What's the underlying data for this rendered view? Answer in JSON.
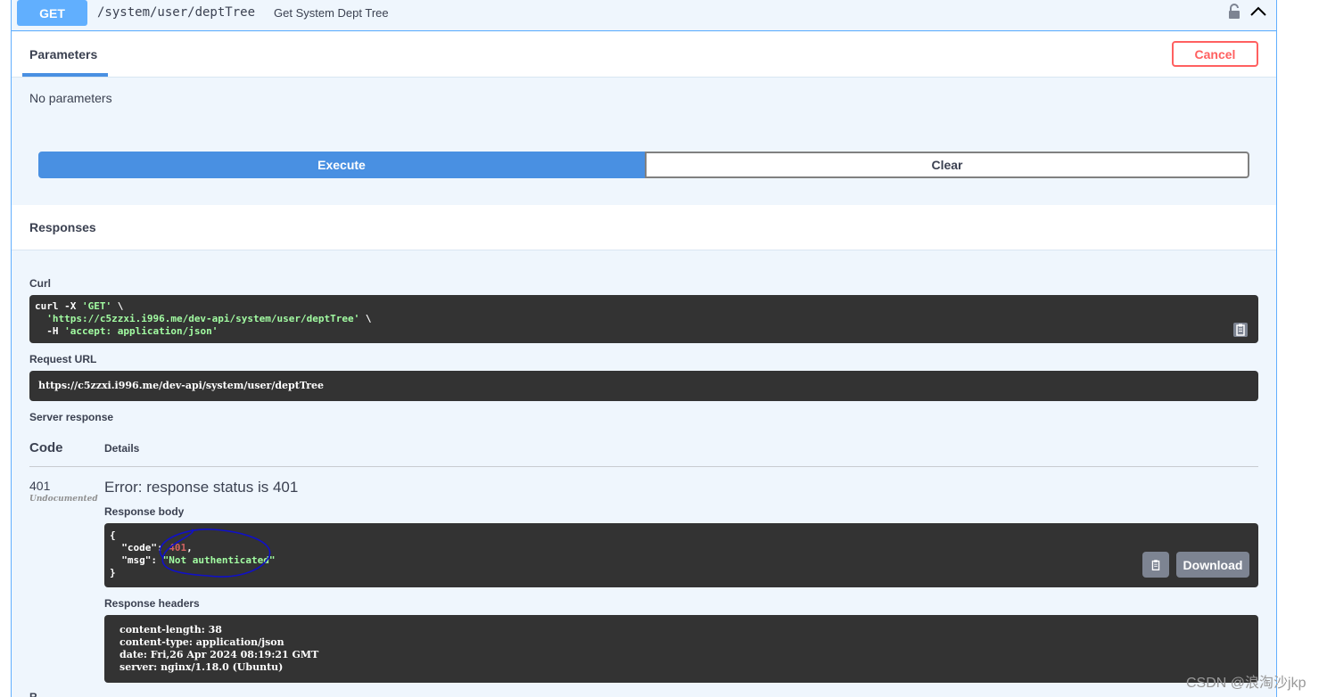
{
  "operation": {
    "method": "GET",
    "path": "/system/user/deptTree",
    "summary": "Get System Dept Tree"
  },
  "parameters": {
    "tab_label": "Parameters",
    "cancel_label": "Cancel",
    "empty_text": "No parameters"
  },
  "actions": {
    "execute_label": "Execute",
    "clear_label": "Clear"
  },
  "responses": {
    "title": "Responses",
    "curl_label": "Curl",
    "curl_lines": {
      "line1_prefix": "curl -X ",
      "line1_method": "'GET'",
      "line1_suffix": " \\",
      "line2_url": "'https://c5zzxi.i996.me/dev-api/system/user/deptTree'",
      "line2_suffix": " \\",
      "line3_prefix": "  -H ",
      "line3_header": "'accept: application/json'"
    },
    "request_url_label": "Request URL",
    "request_url": "https://c5zzxi.i996.me/dev-api/system/user/deptTree",
    "server_response_label": "Server response",
    "code_header": "Code",
    "details_header": "Details",
    "status_code": "401",
    "status_note": "Undocumented",
    "error_text": "Error: response status is 401",
    "body_label": "Response body",
    "body": {
      "open": "{",
      "code_key": "  \"code\": ",
      "code_value": "401",
      "code_comma": ",",
      "msg_key": "  \"msg\": ",
      "msg_value": "\"Not authenticated\"",
      "close": "}"
    },
    "download_label": "Download",
    "headers_label": "Response headers",
    "headers": [
      "content-length: 38",
      "content-type: application/json",
      "date: Fri,26 Apr 2024 08:19:21 GMT",
      "server: nginx/1.18.0 (Ubuntu)"
    ],
    "partial_label": "R"
  },
  "watermark": "CSDN @浪淘沙jkp",
  "colors": {
    "get_method": "#61affe",
    "execute": "#4990e2",
    "cancel": "#ff6060",
    "code_bg": "#333333",
    "annotation_pen": "#1010c8"
  },
  "icons": [
    "lock-icon",
    "chevron-up-icon",
    "copy-icon"
  ]
}
